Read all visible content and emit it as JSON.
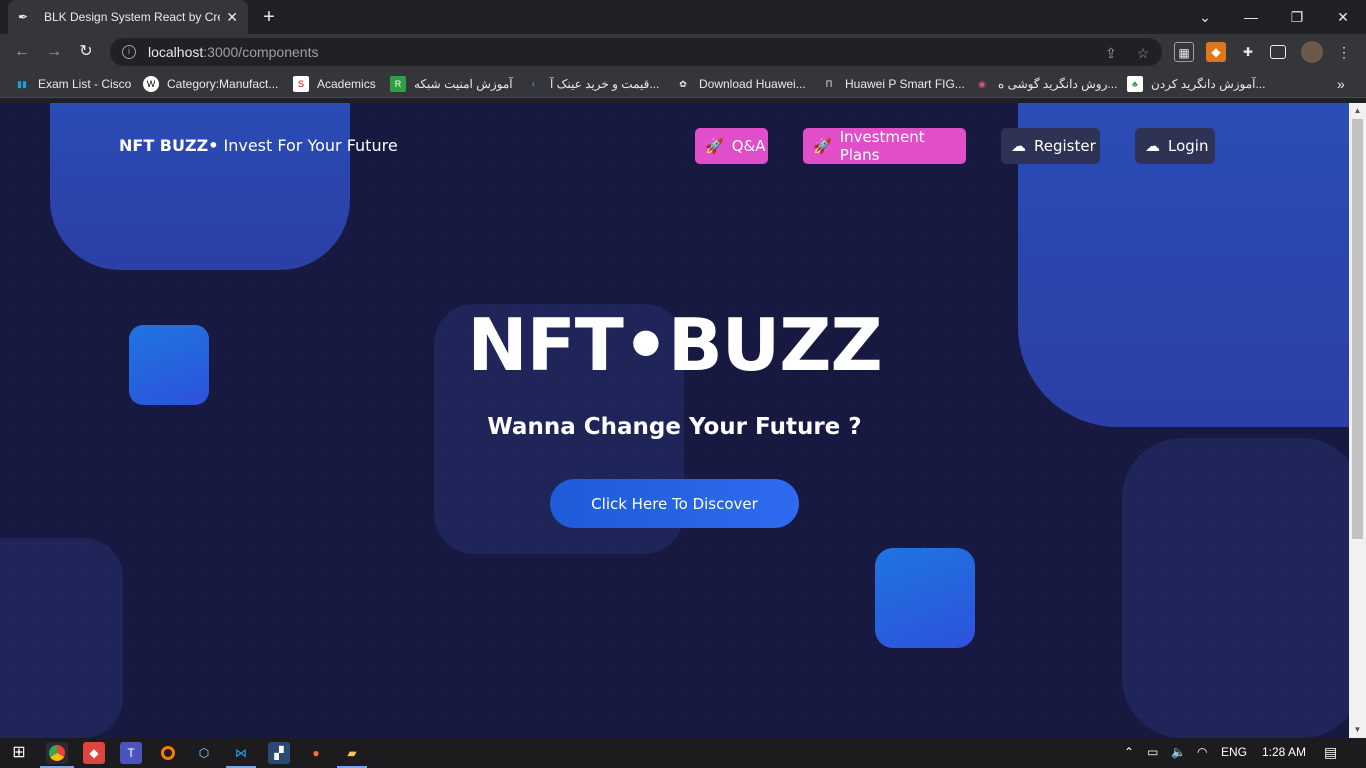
{
  "browser": {
    "tab_title": "BLK Design System React by Crea",
    "tab_close": "✕",
    "new_tab": "+",
    "url_host": "localhost",
    "url_path": ":3000/components",
    "window_controls": [
      "⌄",
      "—",
      "❐",
      "✕"
    ]
  },
  "bookmarks": [
    {
      "label": "Exam List - Cisco",
      "icon": "cisco-icon"
    },
    {
      "label": "Category:Manufact...",
      "icon": "wikipedia-icon"
    },
    {
      "label": "Academics",
      "icon": "s-icon"
    },
    {
      "label": "آموزش امنیت شبکه",
      "icon": "r-icon"
    },
    {
      "label": "قیمت و خرید عینک آ...",
      "icon": "glasses-icon"
    },
    {
      "label": "Download Huawei...",
      "icon": "huawei-icon"
    },
    {
      "label": "Huawei P Smart FIG...",
      "icon": "huawei2-icon"
    },
    {
      "label": "روش دانگرید گوشی ه...",
      "icon": "dribbble-icon"
    },
    {
      "label": "آموزش دانگرید کردن...",
      "icon": "leaf-icon"
    }
  ],
  "page": {
    "brand_bold": "NFT BUZZ•",
    "brand_rest": " Invest For Your Future",
    "nav": [
      {
        "label": "Q&A",
        "icon": "rocket-icon"
      },
      {
        "label": "Investment Plans",
        "icon": "rocket-icon"
      },
      {
        "label": "Register",
        "icon": "cloud-download-icon"
      },
      {
        "label": "Login",
        "icon": "cloud-download-icon"
      }
    ],
    "hero_title": "NFT•BUZZ",
    "hero_subtitle": "Wanna Change Your Future ?",
    "cta_label": "Click Here To Discover"
  },
  "taskbar": {
    "lang": "ENG",
    "time": "1:28 AM"
  },
  "colors": {
    "page_bg": "#171941",
    "pink": "#e14eca",
    "cta_blue": "#2f6bf0"
  }
}
